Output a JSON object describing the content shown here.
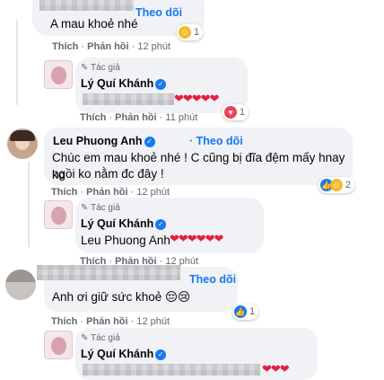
{
  "comments": [
    {
      "follow_label": "Theo dõi",
      "text": "A mau khoẻ nhé",
      "actions": {
        "like": "Thích",
        "reply": "Phản hồi",
        "time": "12 phút"
      },
      "reaction_count": "1"
    },
    {
      "author_tag": "Tác giả",
      "name": "Lý Quí Khánh",
      "text_hearts": "❤❤❤❤❤",
      "actions": {
        "like": "Thích",
        "reply": "Phản hồi",
        "time": "11 phút"
      },
      "reaction_count": "1"
    },
    {
      "name": "Leu Phuong Anh",
      "follow_label": "Theo dõi",
      "text_line1": "Chúc em mau khoẻ nhé ! C cũng bị đĩa đệm mấy hnay ko",
      "text_line2": "ngồi ko nằm đc đây !",
      "actions": {
        "like": "Thích",
        "reply": "Phản hồi",
        "time": "12 phút"
      },
      "reaction_count": "2"
    },
    {
      "author_tag": "Tác giả",
      "name": "Lý Quí Khánh",
      "mention": "Leu Phuong Anh",
      "text_hearts": "❤❤❤❤❤❤",
      "actions": {
        "like": "Thích",
        "reply": "Phản hồi",
        "time": "12 phút"
      }
    },
    {
      "follow_label": "Theo dõi",
      "text": "Anh ơi giữ sức khoẻ 😔😢",
      "actions": {
        "like": "Thích",
        "reply": "Phản hồi",
        "time": "12 phút"
      },
      "reaction_count": "1"
    },
    {
      "author_tag": "Tác giả",
      "name": "Lý Quí Khánh",
      "text_hearts": "❤❤❤"
    }
  ],
  "colors": {
    "link": "#1877f2",
    "bubble": "#f0f2f5",
    "heart": "#e41e3f",
    "meta": "#65676b"
  }
}
